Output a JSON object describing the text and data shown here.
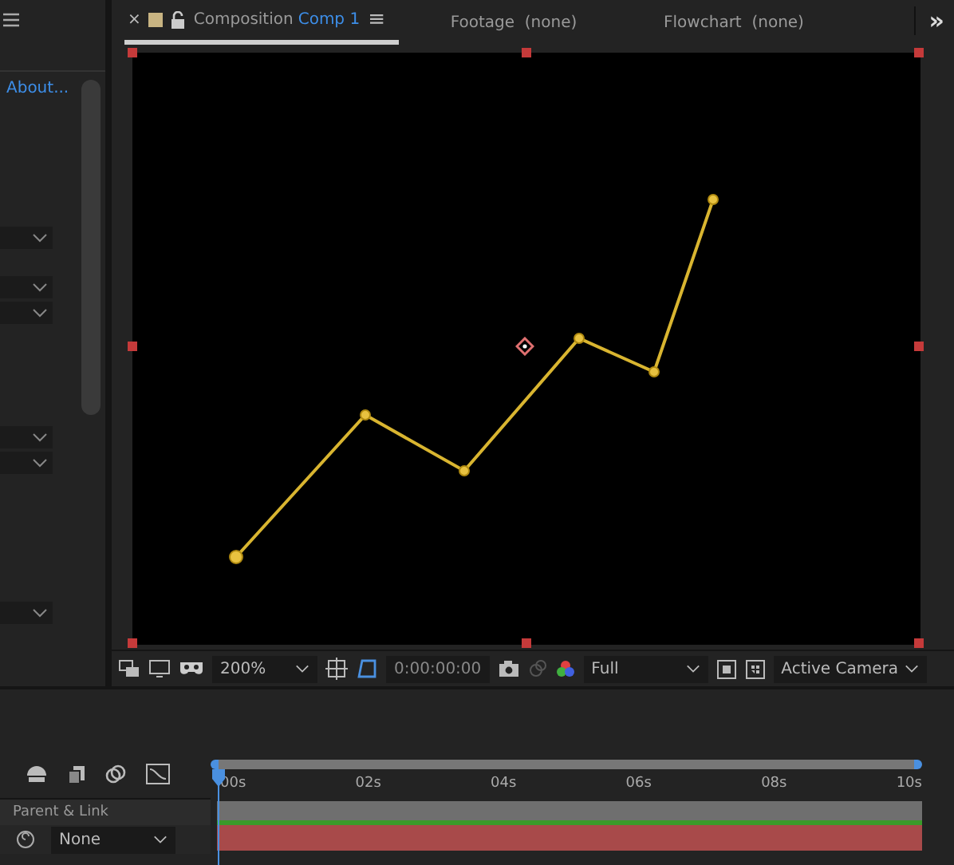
{
  "left_panel": {
    "link": "About..."
  },
  "tabs": [
    {
      "kind": "composition",
      "close": "×",
      "label": "Composition",
      "name": "Comp 1",
      "menu": "≡",
      "selected": true
    },
    {
      "kind": "plain",
      "label": "Footage",
      "name": "(none)",
      "selected": false
    },
    {
      "kind": "plain",
      "label": "Flowchart",
      "name": "(none)",
      "selected": false
    }
  ],
  "overflow": "»",
  "viewer_toolbar": {
    "zoom": "200%",
    "timecode": "0:00:00:00",
    "resolution": "Full",
    "view": "Active Camera"
  },
  "timeline": {
    "ruler": [
      "00s",
      "02s",
      "04s",
      "06s",
      "08s",
      "10s"
    ],
    "column_header": "Parent & Link",
    "parent": "None"
  }
}
